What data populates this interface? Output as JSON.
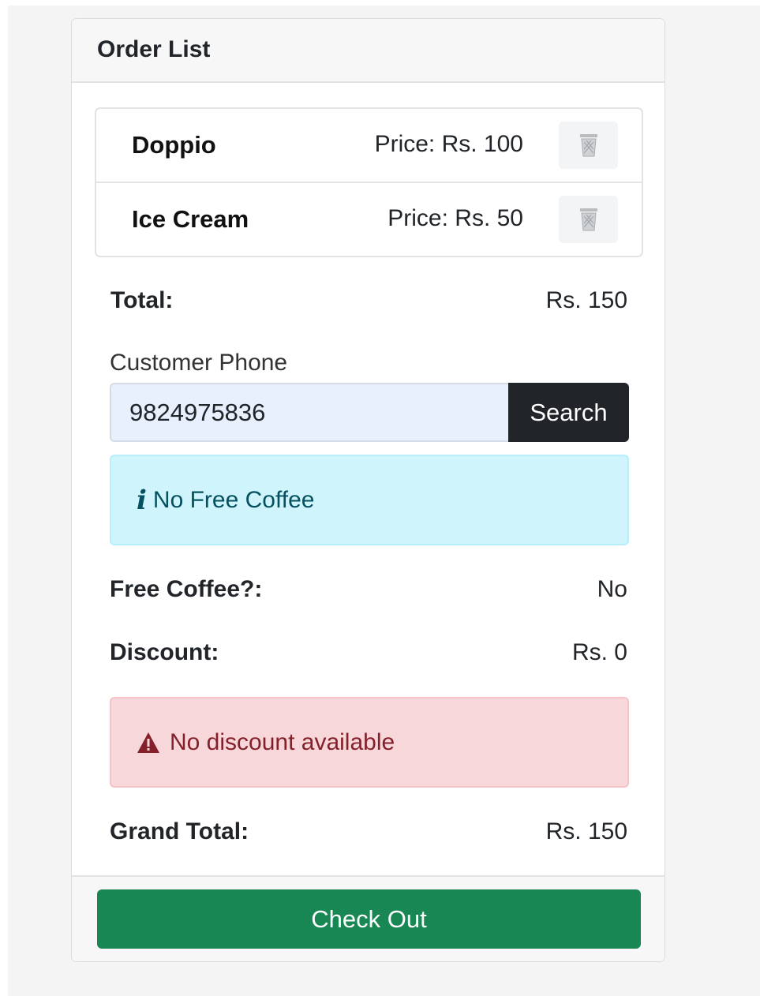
{
  "header": {
    "title": "Order List"
  },
  "items": [
    {
      "name": "Doppio",
      "price": "Price: Rs. 100",
      "delete_icon": "trash-icon"
    },
    {
      "name": "Ice Cream",
      "price": "Price: Rs. 50",
      "delete_icon": "trash-icon"
    }
  ],
  "summary": {
    "total_label": "Total:",
    "total_value": "Rs. 150"
  },
  "customer": {
    "phone_label": "Customer Phone",
    "phone_value": "9824975836",
    "search_label": "Search"
  },
  "free_coffee_alert": {
    "icon": "info-icon",
    "text": "No Free Coffee",
    "color": "#055160",
    "background": "#cff4fc"
  },
  "free_coffee": {
    "label": "Free Coffee?:",
    "value": "No"
  },
  "discount": {
    "label": "Discount:",
    "value": "Rs. 0"
  },
  "discount_alert": {
    "icon": "warning-icon",
    "text": "No discount available",
    "color": "#842029",
    "background": "#f8d7da"
  },
  "grand_total": {
    "label": "Grand Total:",
    "value": "Rs. 150"
  },
  "footer": {
    "checkout_label": "Check Out",
    "checkout_color": "#198754"
  }
}
